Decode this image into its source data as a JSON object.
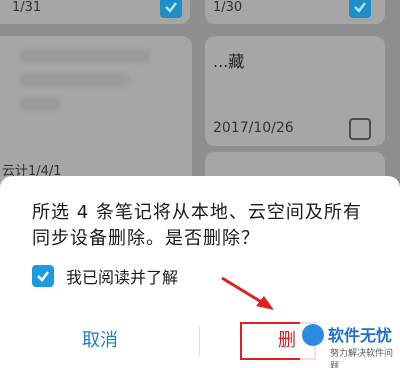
{
  "background": {
    "card_top_left_date": "1/31",
    "card_top_right_date": "1/30",
    "card_mid_right_title": "...藏",
    "card_mid_right_date": "2017/10/26",
    "card_mid_left_partial": "云计1/4/1"
  },
  "dialog": {
    "message": "所选 4 条笔记将从本地、云空间及所有同步设备删除。是否删除？",
    "confirm_label": "我已阅读并了解",
    "confirm_checked": true,
    "cancel_label": "取消",
    "delete_label": "删"
  },
  "watermark": {
    "title": "软件无忧",
    "subtitle": "努力解决软件问题"
  },
  "colors": {
    "accent": "#1e9be0",
    "button_text": "#1e7fc0",
    "annotation": "#e02020"
  }
}
